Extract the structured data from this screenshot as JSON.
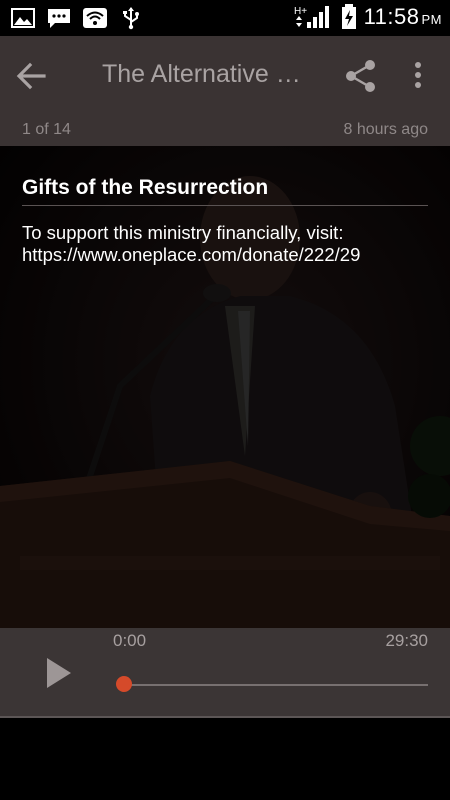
{
  "status_bar": {
    "time": "11:58",
    "ampm": "PM",
    "network_label": "H+"
  },
  "app_bar": {
    "title": "The Alternative with Dr. Tony Evans",
    "counter": "1 of 14",
    "time_ago": "8 hours ago"
  },
  "episode": {
    "title": "Gifts of the Resurrection",
    "description_line1": "To support this ministry financially, visit:",
    "description_line2": "https://www.oneplace.com/donate/222/29"
  },
  "player": {
    "current_time": "0:00",
    "duration": "29:30",
    "progress": 0,
    "accent_color": "#d54a2a"
  },
  "colors": {
    "app_bar_bg": "#3a3333",
    "player_bg": "#3b3535"
  }
}
